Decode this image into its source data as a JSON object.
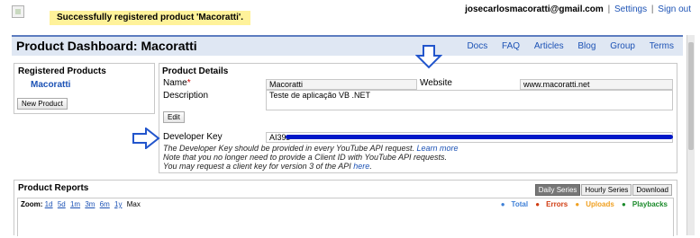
{
  "header": {
    "notice": "Successfully registered product 'Macoratti'.",
    "user_email": "josecarlosmacoratti@gmail.com",
    "settings_label": "Settings",
    "signout_label": "Sign out",
    "separator": "|"
  },
  "titlebar": {
    "title": "Product Dashboard: Macoratti",
    "nav": [
      "Docs",
      "FAQ",
      "Articles",
      "Blog",
      "Group",
      "Terms"
    ]
  },
  "registered_products": {
    "heading": "Registered Products",
    "products": [
      "Macoratti"
    ],
    "new_product_label": "New Product"
  },
  "product_details": {
    "heading": "Product Details",
    "name_label": "Name",
    "required_mark": "*",
    "name_value": "Macoratti",
    "website_label": "Website",
    "website_value": "www.macoratti.net",
    "description_label": "Description",
    "description_value": "Teste de aplicação VB .NET",
    "edit_label": "Edit",
    "developer_key_label": "Developer Key",
    "developer_key_visible": "AI39s",
    "help_line1": "The Developer Key should be provided in every YouTube API request.",
    "learn_more": "Learn more",
    "help_line2": "Note that you no longer need to provide a Client ID with YouTube API requests.",
    "help_line3": "You may request a client key for version 3 of the API",
    "here_label": "here",
    "period": "."
  },
  "product_reports": {
    "heading": "Product Reports",
    "tabs": [
      "Daily Series",
      "Hourly Series",
      "Download"
    ],
    "zoom_label": "Zoom:",
    "zoom_options": [
      "1d",
      "5d",
      "1m",
      "3m",
      "6m",
      "1y"
    ],
    "zoom_max": "Max",
    "legend": [
      {
        "label": "Total",
        "color": "#3d7fd6"
      },
      {
        "label": "Errors",
        "color": "#d03b10"
      },
      {
        "label": "Uploads",
        "color": "#f0a020"
      },
      {
        "label": "Playbacks",
        "color": "#1a8a2a"
      }
    ]
  },
  "colors": {
    "link": "#1c52b5",
    "notice_bg": "#fff29a",
    "titlebar_bg": "#dfe7f3",
    "arrow": "#2255cc",
    "redaction": "#0018c8"
  }
}
